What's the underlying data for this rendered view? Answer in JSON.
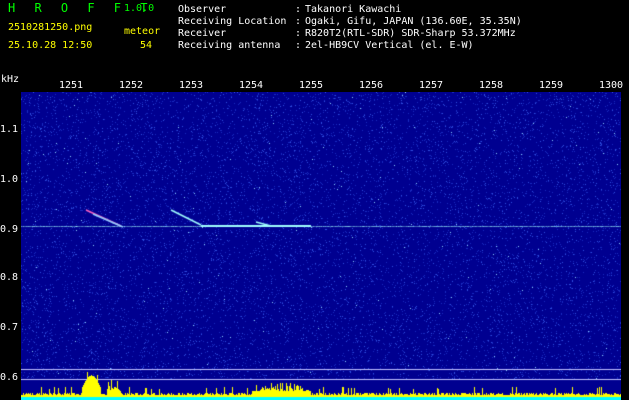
{
  "app": {
    "title": "H R O F F T",
    "version": "1.0.0",
    "filename": "2510281250.png",
    "timestamp": "25.10.28 12:50",
    "meteor_label": "meteor",
    "meteor_count": "54"
  },
  "info": {
    "labels": [
      "Observer",
      "Receiving Location",
      "Receiver",
      "Receiving antenna"
    ],
    "separator": ":",
    "values": [
      "Takanori Kawachi",
      "Ogaki, Gifu, JAPAN (136.60E, 35.35N)",
      "R820T2(RTL-SDR) SDR-Sharp 53.372MHz",
      "2el-HB9CV Vertical (el. E-W)"
    ]
  },
  "spectrogram": {
    "y_unit": "kHz",
    "time_ticks": [
      "1251",
      "1252",
      "1253",
      "1254",
      "1255",
      "1256",
      "1257",
      "1258",
      "1259",
      "1300"
    ],
    "freq_ticks": [
      "1.1",
      "1.0",
      "0.9",
      "0.8",
      "0.7",
      "0.6"
    ],
    "colors": {
      "background": "#000090",
      "noise_dim": "#1a2cc0",
      "noise_bright": "#8fd0ff",
      "carrier": "#a0ffff",
      "meteor": "#ff60c0",
      "level_bar": "#ffff00",
      "baseline": "#00ffff"
    }
  }
}
